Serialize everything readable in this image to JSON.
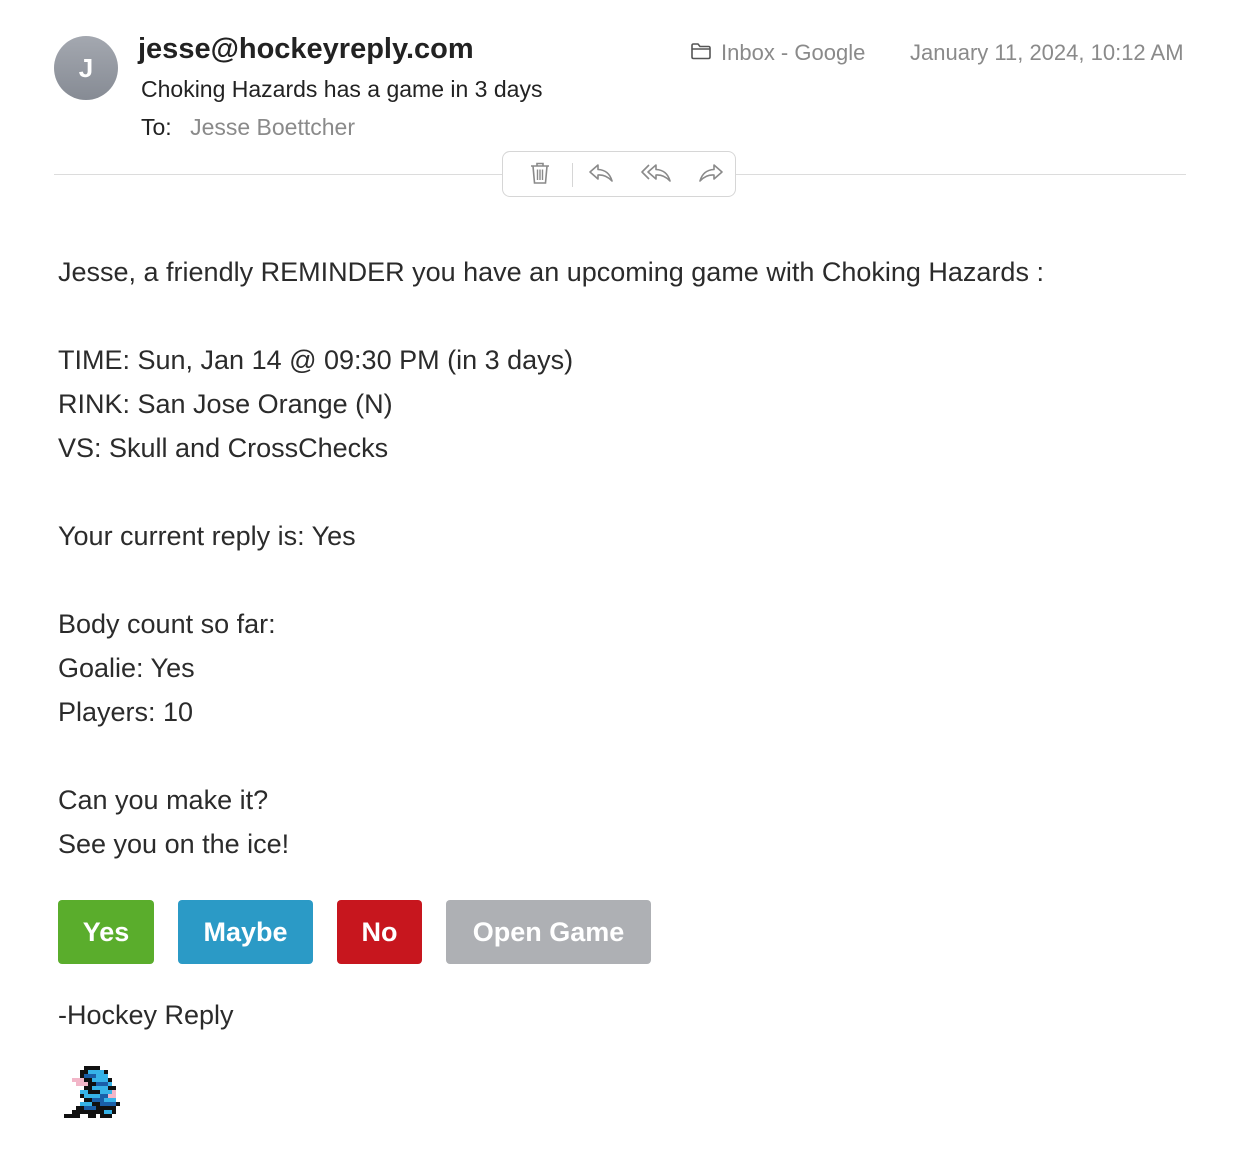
{
  "header": {
    "avatar_initial": "J",
    "from": "jesse@hockeyreply.com",
    "subject": "Choking Hazards has a game in 3 days",
    "to_label": "To:",
    "to_name": "Jesse Boettcher",
    "mailbox": "Inbox - Google",
    "date": "January 11, 2024, 10:12 AM"
  },
  "toolbar": {
    "icons": [
      "trash-icon",
      "reply-icon",
      "reply-all-icon",
      "forward-icon"
    ]
  },
  "message": {
    "intro": "Jesse, a friendly REMINDER you have an upcoming game with Choking Hazards :",
    "time": "TIME: Sun, Jan 14 @ 09:30 PM (in 3 days)",
    "rink": "RINK: San Jose Orange (N)",
    "vs": "VS: Skull and CrossChecks",
    "current_reply": "Your current reply is: Yes",
    "body_count": "Body count so far:",
    "goalie": "Goalie: Yes",
    "players": "Players: 10",
    "question": "Can you make it?",
    "closing": "See you on the ice!",
    "signature": "-Hockey Reply"
  },
  "buttons": {
    "yes": "Yes",
    "maybe": "Maybe",
    "no": "No",
    "open_game": "Open Game"
  },
  "colors": {
    "yes": "#5aad2c",
    "maybe": "#2b9ac6",
    "no": "#c7161e",
    "open_game": "#aeb0b4"
  }
}
